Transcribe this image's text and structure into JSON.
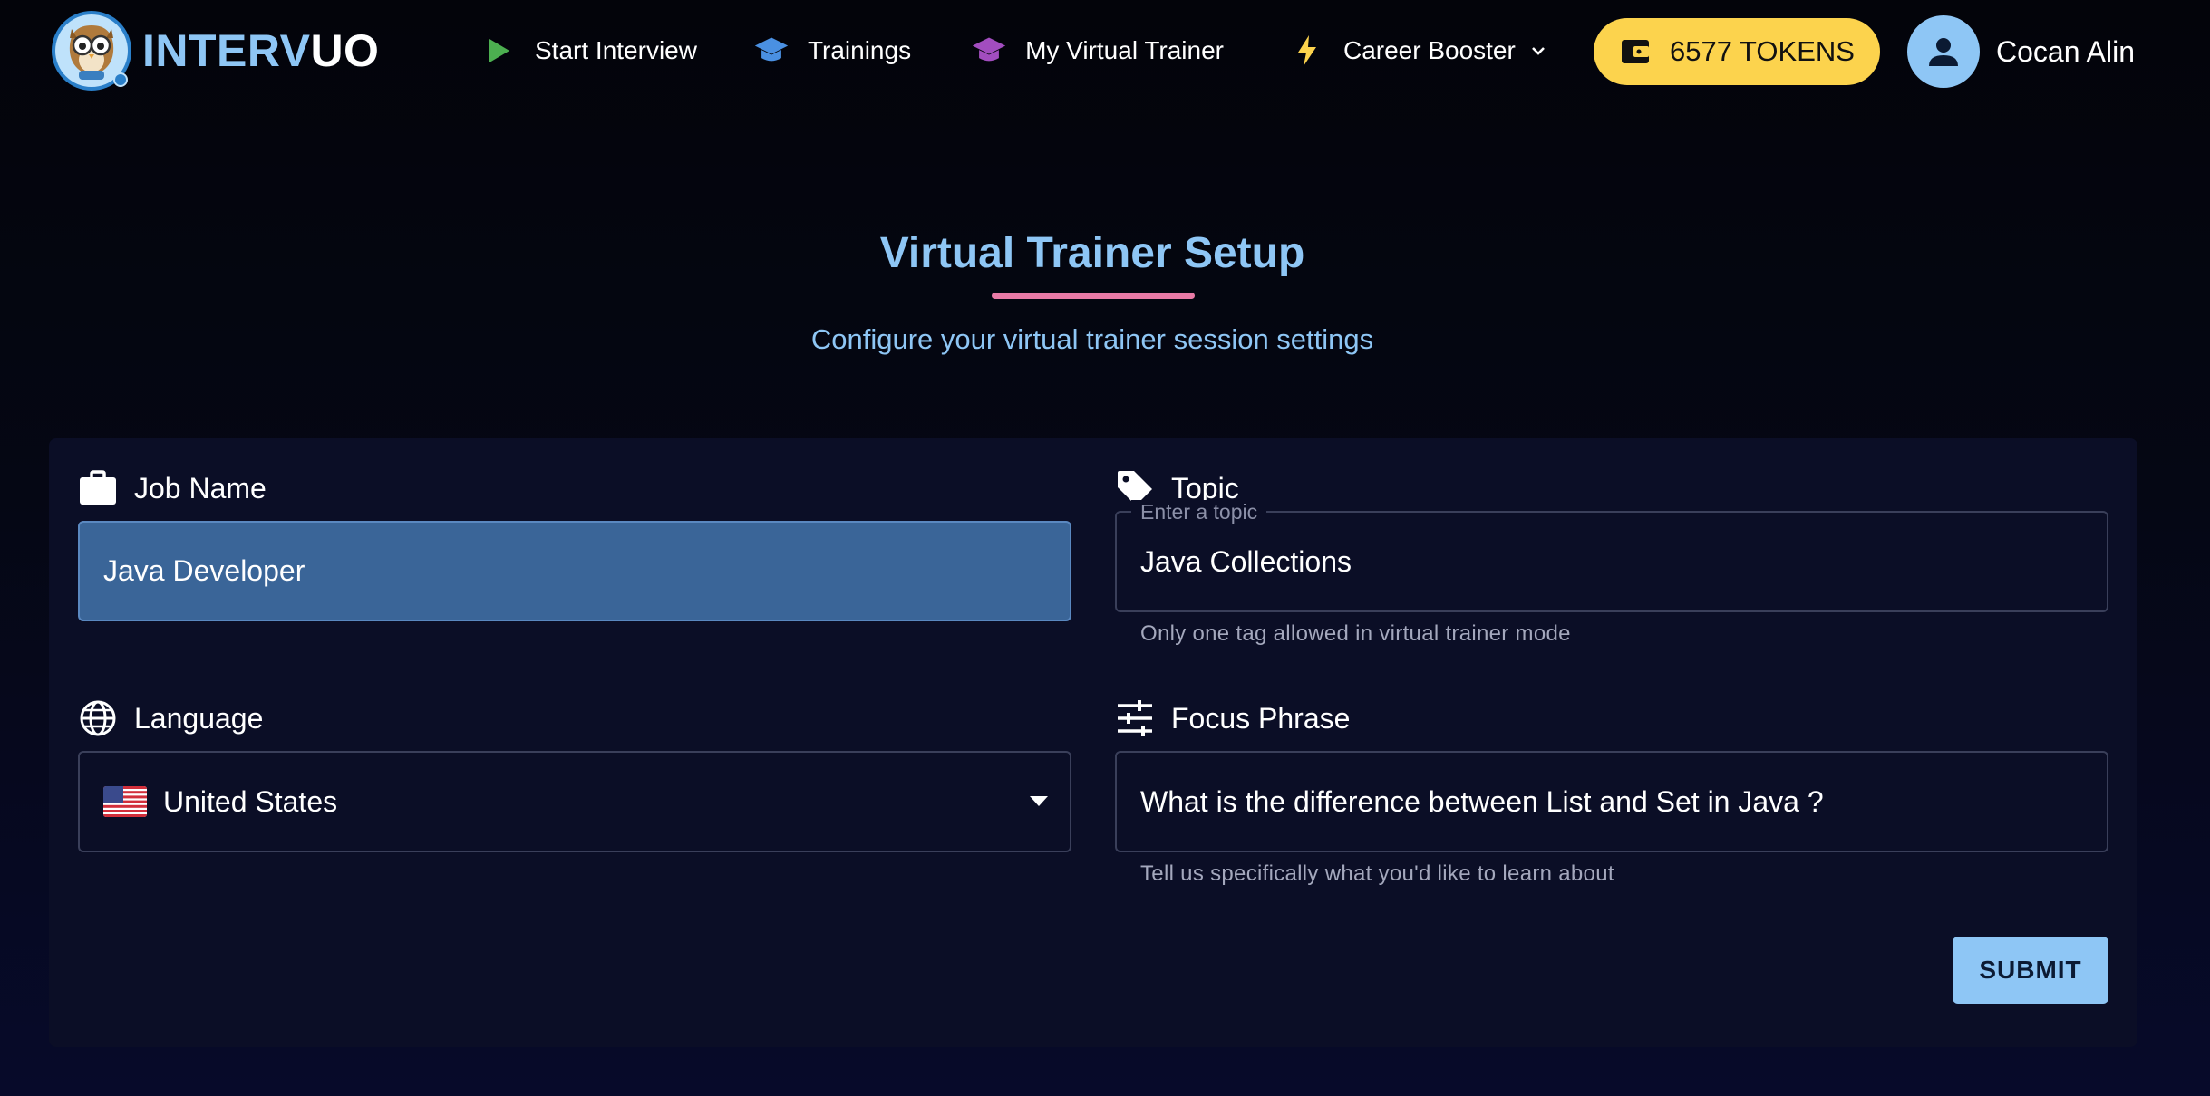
{
  "brand": {
    "name_part1": "INTERV",
    "name_part2": "UO",
    "accent": "#8ec6f5"
  },
  "nav": {
    "items": [
      {
        "label": "Start Interview",
        "icon": "play-icon",
        "color": "#4caf50"
      },
      {
        "label": "Trainings",
        "icon": "graduation-cap-icon",
        "color": "#4a90e2"
      },
      {
        "label": "My Virtual Trainer",
        "icon": "graduation-cap-icon",
        "color": "#a24dbf"
      },
      {
        "label": "Career Booster",
        "icon": "lightning-icon",
        "color": "#fcd34d",
        "has_dropdown": true
      }
    ],
    "tokens_label": "6577 TOKENS",
    "tokens_color": "#fcd34d",
    "user_name": "Cocan Alin"
  },
  "header": {
    "title": "Virtual Trainer Setup",
    "subtitle": "Configure your virtual trainer session settings",
    "underline_color": "#e97aa6"
  },
  "form": {
    "job_name": {
      "label": "Job Name",
      "icon": "briefcase-icon",
      "value": "Java Developer"
    },
    "topic": {
      "label": "Topic",
      "icon": "tag-icon",
      "floating_label": "Enter a topic",
      "value": "Java Collections",
      "helper": "Only one tag allowed in virtual trainer mode"
    },
    "language": {
      "label": "Language",
      "icon": "globe-icon",
      "value": "United States",
      "flag": "us-flag-icon"
    },
    "focus_phrase": {
      "label": "Focus Phrase",
      "icon": "sliders-icon",
      "value": "What is the difference between List and Set in Java ?",
      "helper": "Tell us specifically what you'd like to learn about"
    },
    "submit_label": "SUBMIT"
  }
}
